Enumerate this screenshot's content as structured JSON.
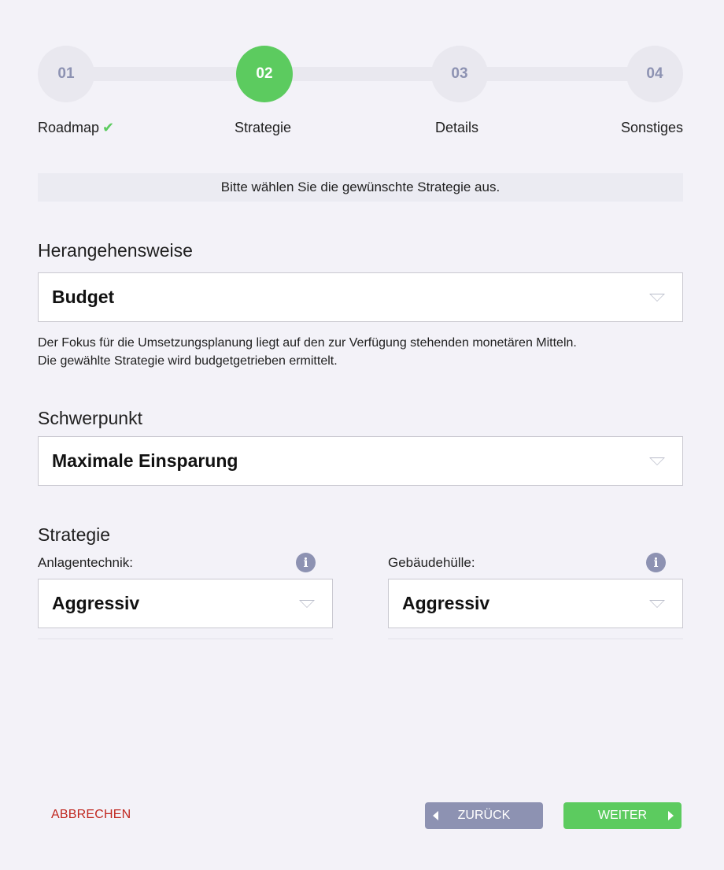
{
  "stepper": {
    "steps": [
      {
        "number": "01",
        "label": "Roadmap",
        "completed": true,
        "active": false
      },
      {
        "number": "02",
        "label": "Strategie",
        "completed": false,
        "active": true
      },
      {
        "number": "03",
        "label": "Details",
        "completed": false,
        "active": false
      },
      {
        "number": "04",
        "label": "Sonstiges",
        "completed": false,
        "active": false
      }
    ],
    "check_icon": "check-icon",
    "active_color": "#5ccb5f",
    "inactive_color": "#e9e8ef"
  },
  "info_bar": {
    "text": "Bitte wählen Sie die gewünschte Strategie aus."
  },
  "approach": {
    "title": "Herangehensweise",
    "selected": "Budget",
    "description_line1": "Der Fokus für die Umsetzungsplanung liegt auf den zur Verfügung stehenden monetären Mitteln.",
    "description_line2": "Die gewählte Strategie wird budgetgetrieben ermittelt."
  },
  "focus": {
    "title": "Schwerpunkt",
    "selected": "Maximale Einsparung"
  },
  "strategy": {
    "title": "Strategie",
    "system_tech": {
      "label": "Anlagentechnik:",
      "selected": "Aggressiv",
      "icon": "info-icon"
    },
    "building_envelope": {
      "label": "Gebäudehülle:",
      "selected": "Aggressiv",
      "icon": "info-icon"
    }
  },
  "footer": {
    "cancel_label": "ABBRECHEN",
    "back_label": "ZURÜCK",
    "next_label": "WEITER",
    "cancel_color": "#c0271f",
    "back_color": "#8d92b2",
    "next_color": "#5ccb5f"
  }
}
